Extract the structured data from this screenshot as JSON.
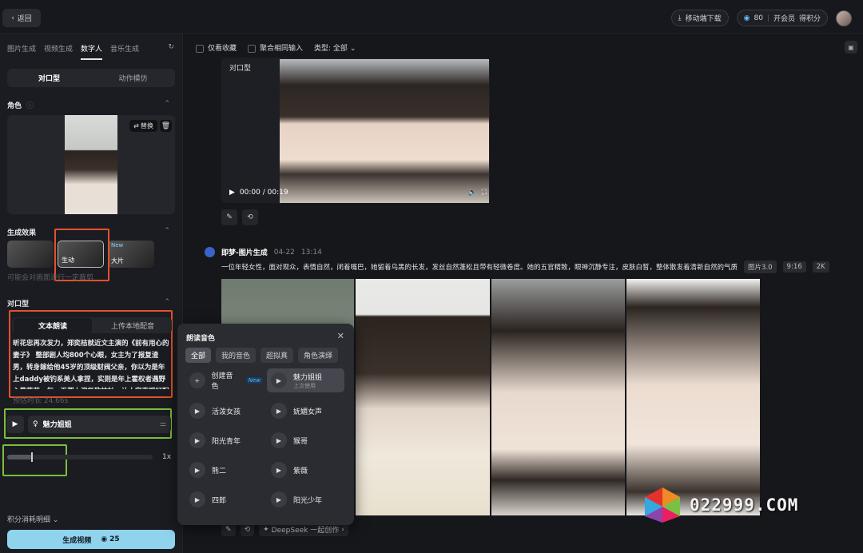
{
  "top": {
    "back": "返回",
    "download": "移动端下载",
    "points": "80",
    "vip": "开会员",
    "earn": "得积分"
  },
  "sidebar": {
    "tabs": [
      "图片生成",
      "视频生成",
      "数字人",
      "音乐生成"
    ],
    "mode": [
      "对口型",
      "动作模仿"
    ],
    "role_title": "角色",
    "swap": "替换",
    "effects_title": "生成效果",
    "effects": [
      "",
      "生动",
      "大片"
    ],
    "effect_new": "New",
    "effect_note": "可能会对画面进行一定裁剪",
    "lip_title": "对口型",
    "text_tabs": [
      "文本朗读",
      "上传本地配音"
    ],
    "paragraph": "昕花忠再次发力，郑奕桔就近文主演的《前有用心的妻子》 整部剧人均800个心眼，女主为了报复渣男，转身嫁给他45岁的顶级财阀父亲，你以为是年上daddy被钓系美人拿捏，实则是年上霍权者遇野心黑莲花，每一天都上演极致拉扯，让大家直呼好配",
    "duration": "预估时长 24.66s",
    "voice": "魅力姐姐",
    "speed_value": "1x",
    "speed_level": 0.17,
    "cost": "积分消耗明细",
    "generate": "生成视频",
    "generate_cost": "25"
  },
  "main": {
    "filters": [
      "仅看收藏",
      "聚合相同输入"
    ],
    "type_label": "类型: 全部",
    "video_label": "对口型",
    "time": "00:00 / 00:19",
    "gen_title": "即梦-图片生成",
    "gen_date": "04-22",
    "gen_time": "13:14",
    "prompt": "一位年轻女性，面对观众，表情自然，闭着嘴巴，她留着乌黑的长发，发丝自然蓬松且带有轻微卷度。她的五官精致，眼神沉静专注，皮肤白皙，整体散发着清新自然的气质",
    "tags": [
      "图片3.0",
      "9:16",
      "2K"
    ],
    "deepseek": "DeepSeek 一起创作"
  },
  "popup": {
    "title": "朗读音色",
    "tabs": [
      "全部",
      "我的音色",
      "超拟真",
      "角色演绎"
    ],
    "create": "创建音色",
    "new": "New",
    "voices": [
      "魅力姐姐",
      "活泼女孩",
      "妩媚女声",
      "阳光青年",
      "猴哥",
      "熊二",
      "紫薇",
      "四郎",
      "阳光少年"
    ],
    "recent": "上次使用"
  },
  "watermark": "022999.COM"
}
